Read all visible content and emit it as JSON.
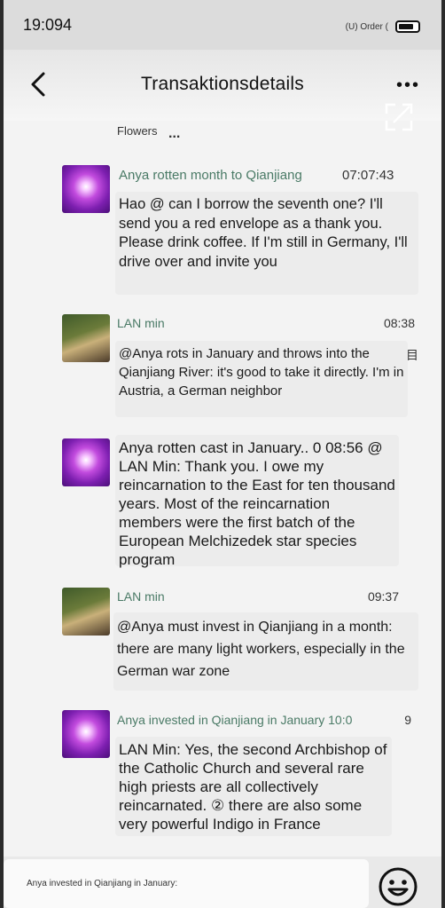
{
  "status_bar": {
    "time": "19:094",
    "right_text": "(U) Order  (",
    "battery_icon": "battery-icon"
  },
  "nav": {
    "title": "Transaktionsdetails",
    "back_icon": "chevron-left-icon",
    "more_icon": "more-horizontal-icon",
    "more_label": "•••",
    "expand_icon": "expand-icon"
  },
  "top_fragment": {
    "label": "Flowers",
    "ellipsis": "..."
  },
  "messages": [
    {
      "sender": "Anya rotten month to Qianjiang",
      "time": "07:07:43",
      "avatar": "purple-light-avatar",
      "text": "Hao @ can I borrow the seventh one? I'll send you a red envelope as a thank you. Please drink coffee. If I'm still in Germany, I'll drive over and invite you"
    },
    {
      "sender": "LAN min",
      "time": "08:38",
      "avatar": "man-photo-avatar",
      "text": "@Anya rots in January and throws into the Qianjiang River: it's good to take it directly. I'm in Austria, a German neighbor",
      "side_glyph": "目"
    },
    {
      "sender": "",
      "time": "",
      "avatar": "purple-light-avatar",
      "text": "Anya rotten cast in January.. 0 08:56 @ LAN Min: Thank you. I owe my reincarnation to the East for ten thousand years. Most of the reincarnation members were the first batch of the European Melchizedek star species program"
    },
    {
      "sender": "LAN min",
      "time": "09:37",
      "avatar": "man-photo-avatar",
      "text": "@Anya must invest in Qianjiang in a month: there are many light workers, especially in the German war zone"
    },
    {
      "sender": "Anya invested in Qianjiang in January 10:0",
      "time": "9",
      "avatar": "purple-light-avatar",
      "text": "LAN Min: Yes, the second Archbishop of the Catholic Church and several rare high priests are all collectively reincarnated. ② there are also some very powerful Indigo in France"
    }
  ],
  "bottom": {
    "caption": "Anya invested in Qianjiang in January:",
    "emoji_icon": "smiley-icon"
  }
}
